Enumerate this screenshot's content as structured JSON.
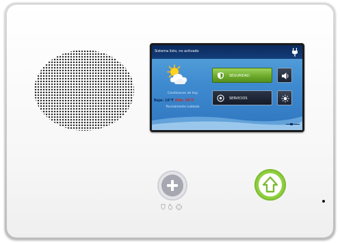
{
  "device": {
    "name": "security touchscreen panel"
  },
  "screen": {
    "status_text": "Sistema listo, no activado",
    "weather": {
      "location": "Condiciones de hoy",
      "low_label": "Baja: 16°F",
      "high_label": "Alta: 56°F",
      "note": "Parcialmente nublado"
    },
    "buttons": {
      "security_label": "SEGURIDAD",
      "services_label": "SERVICIOS"
    }
  },
  "colors": {
    "accent_green": "#8fcf3f",
    "screen_blue": "#3f8bd0",
    "topbar_navy": "#0a2a5c",
    "high_temp_red": "#d0281d"
  },
  "icons": {
    "status": "plug-icon",
    "weather": "partly-cloudy-icon",
    "security": "shield-icon",
    "services": "gear-icon",
    "volume": "speaker-volume-icon",
    "brightness": "brightness-icon",
    "home": "home-arrow-icon",
    "emergency": "plus-icon"
  }
}
